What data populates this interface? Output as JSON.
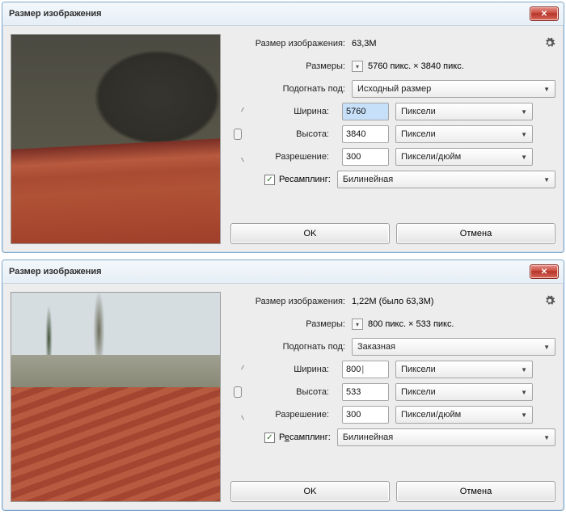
{
  "dialogs": [
    {
      "title": "Размер изображения",
      "size_label": "Размер изображения:",
      "size_value": "63,3M",
      "dims_label": "Размеры:",
      "dims_value": "5760 пикс. × 3840 пикс.",
      "fit_label": "Подогнать под:",
      "fit_value": "Исходный размер",
      "width_label": "Ширина:",
      "width_value": "5760",
      "height_label": "Высота:",
      "height_value": "3840",
      "res_label": "Разрешение:",
      "res_value": "300",
      "unit_px": "Пиксели",
      "unit_res": "Пиксели/дюйм",
      "resample_label": "Ресамплинг:",
      "resample_value": "Билинейная",
      "ok": "OK",
      "cancel": "Отмена",
      "width_selected": true,
      "width_caret": false
    },
    {
      "title": "Размер изображения",
      "size_label": "Размер изображения:",
      "size_value": "1,22M (было 63,3M)",
      "dims_label": "Размеры:",
      "dims_value": "800 пикс. × 533 пикс.",
      "fit_label": "Подогнать под:",
      "fit_value": "Заказная",
      "width_label": "Ширина:",
      "width_value": "800",
      "height_label": "Высота:",
      "height_value": "533",
      "res_label": "Разрешение:",
      "res_value": "300",
      "unit_px": "Пиксели",
      "unit_res": "Пиксели/дюйм",
      "resample_label": "Ресамплинг:",
      "resample_value": "Билинейная",
      "ok": "OK",
      "cancel": "Отмена",
      "width_selected": false,
      "width_caret": true
    }
  ]
}
